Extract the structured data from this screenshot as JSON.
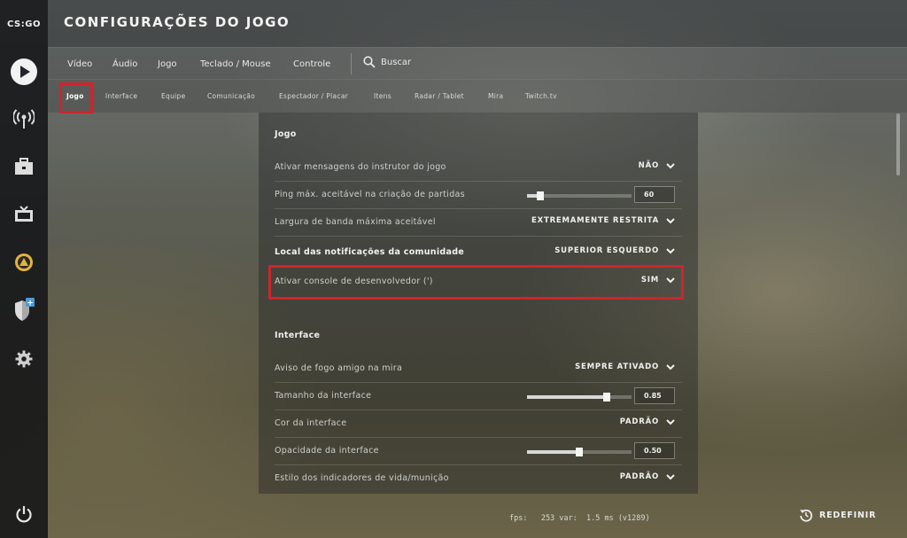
{
  "sidebar": {
    "logo": "CS:GO",
    "icons": [
      "play-icon",
      "antenna-icon",
      "briefcase-icon",
      "tv-icon",
      "rank-icon",
      "shield-icon",
      "gear-icon",
      "power-icon"
    ],
    "badge": "+"
  },
  "header": {
    "title": "CONFIGURAÇÕES DO JOGO"
  },
  "nav_primary": {
    "items": [
      "Vídeo",
      "Áudio",
      "Jogo",
      "Teclado / Mouse",
      "Controle"
    ],
    "search_label": "Buscar"
  },
  "nav_secondary": {
    "items": [
      "Jogo",
      "Interface",
      "Equipe",
      "Comunicação",
      "Espectador / Placar",
      "Itens",
      "Radar / Tablet",
      "Mira",
      "Twitch.tv"
    ],
    "active": "Jogo"
  },
  "sections": {
    "game": {
      "title": "Jogo",
      "rows": [
        {
          "label": "Ativar mensagens do instrutor do jogo",
          "value": "NÃO"
        },
        {
          "label": "Ping máx. aceitável na criação de partidas",
          "value": "60",
          "slider_fraction": 0.13
        },
        {
          "label": "Largura de banda máxima aceitável",
          "value": "EXTREMAMENTE RESTRITA"
        },
        {
          "label": "Local das notificações da comunidade",
          "value": "SUPERIOR ESQUERDO"
        },
        {
          "label": "Ativar console de desenvolvedor (')",
          "value": "SIM"
        }
      ]
    },
    "interface": {
      "title": "Interface",
      "rows": [
        {
          "label": "Aviso de fogo amigo na mira",
          "value": "SEMPRE ATIVADO"
        },
        {
          "label": "Tamanho da interface",
          "value": "0.85",
          "slider_fraction": 0.76
        },
        {
          "label": "Cor da interface",
          "value": "PADRÃO"
        },
        {
          "label": "Opacidade da interface",
          "value": "0.50",
          "slider_fraction": 0.5
        },
        {
          "label": "Estilo dos indicadores de vida/munição",
          "value": "PADRÃO"
        }
      ]
    }
  },
  "footer": {
    "fps_text": "fps:   253 var:  1.5 ms (v1289)",
    "reset_label": "REDEFINIR"
  },
  "colors": {
    "highlight": "#d0242c"
  }
}
